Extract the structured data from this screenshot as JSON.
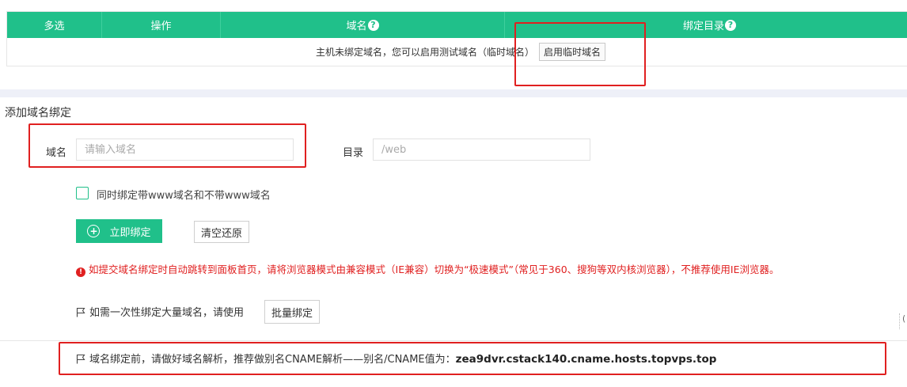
{
  "table": {
    "headers": {
      "select": "多选",
      "actions": "操作",
      "domain": "域名",
      "dir": "绑定目录"
    },
    "help_glyph": "?",
    "empty_text": "主机未绑定域名，您可以启用测试域名（临时域名）",
    "enable_temp_label": "启用临时域名"
  },
  "form": {
    "title": "添加域名绑定",
    "domain_label": "域名",
    "domain_placeholder": "请输入域名",
    "domain_value": "",
    "dir_label": "目录",
    "dir_placeholder": "/web",
    "dir_value": "",
    "www_checkbox_label": "同时绑定带www域名和不带www域名",
    "www_checked": false,
    "bind_button": "立即绑定",
    "bind_icon": "plus-circle-icon",
    "reset_button": "清空还原"
  },
  "notices": {
    "warning": "如提交域名绑定时自动跳转到面板首页，请将浏览器模式由兼容模式（IE兼容）切换为“极速模式”（常见于360、搜狗等双内核浏览器），不推荐使用IE浏览器。",
    "warning_icon": "exclamation-circle-icon",
    "batch_text": "如需一次性绑定大量域名，请使用",
    "batch_button": "批量绑定",
    "cname_text": "域名绑定前，请做好域名解析，推荐做别名CNAME解析——别名/CNAME值为：",
    "cname_value": "zea9dvr.cstack140.cname.hosts.topvps.top",
    "flag_icon": "flag-icon"
  },
  "edge_glyph": "(",
  "colors": {
    "primary": "#20c08a",
    "warning": "#e02020",
    "annotation": "#e02020",
    "band": "#eef0f8"
  }
}
